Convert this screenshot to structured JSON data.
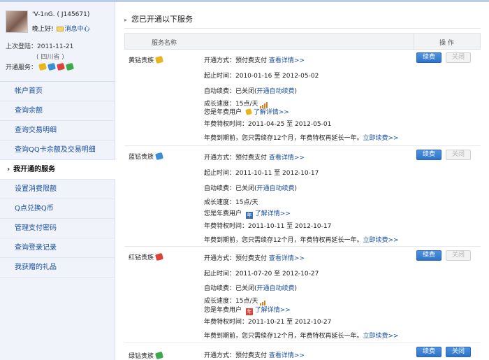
{
  "user": {
    "name": "'V-1nG. ( J145671)",
    "greeting": "晚上好!",
    "message_center": "消息中心",
    "last_login": "上次登陆：2011-11-21",
    "region": "( 四川省 )",
    "services_label": "开通服务："
  },
  "nav": [
    {
      "label": "帐户首页"
    },
    {
      "label": "查询余额"
    },
    {
      "label": "查询交易明细"
    },
    {
      "label": "查询QQ卡余额及交易明细"
    },
    {
      "label": "我开通的服务"
    },
    {
      "label": "设置消费限额"
    },
    {
      "label": "Q点兑换Q币"
    },
    {
      "label": "管理支付密码"
    },
    {
      "label": "查询登录记录"
    },
    {
      "label": "我获赠的礼品"
    }
  ],
  "main": {
    "title": "您已开通以下服务",
    "col_name": "服务名称",
    "col_op": "操  作"
  },
  "colors": {
    "yellow": "#e8b51f",
    "blue": "#3a8fd6",
    "red": "#d9453a",
    "green": "#3caa4a",
    "link": "#1a4fa3",
    "accent": "#2f73c8"
  },
  "rows": [
    {
      "name": "黄钻贵族",
      "pay_method": "开通方式：预付费支付",
      "detail_link": "查看详情>>",
      "time": "起止时间：2010-01-16 至 2012-05-02",
      "auto_renew": "自动续费：已关闭(",
      "auto_renew_link": "开通自动续费",
      "auto_renew_end": ")",
      "speed": "成长速度：15点/天",
      "year_user": "您是年费用户",
      "understand_link": "了解详情>>",
      "privilege": "年费特权时间：2011-04-25 至 2012-05-01",
      "expire": "年费到期前，您只需续存12个月，年费特权再延长一年。",
      "renew_link": "立即续费>>",
      "btn_renew": "续费",
      "btn_close": "关闭",
      "close_enabled": false
    },
    {
      "name": "蓝钻贵族",
      "pay_method": "开通方式：预付费支付",
      "detail_link": "查看详情>>",
      "time": "起止时间：2011-10-11 至 2012-10-17",
      "auto_renew": "自动续费：已关闭(",
      "auto_renew_link": "开通自动续费",
      "auto_renew_end": ")",
      "speed": "成长速度：15点/天",
      "year_user": "您是年费用户",
      "year_badge": "年",
      "understand_link": "了解详情>>",
      "privilege": "年费特权时间：2011-10-11 至 2012-10-17",
      "expire": "年费到期前，您只需续存12个月，年费特权再延长一年。",
      "renew_link": "立即续费>>",
      "btn_renew": "续费",
      "btn_close": "关闭",
      "close_enabled": false
    },
    {
      "name": "红钻贵族",
      "pay_method": "开通方式：预付费支付",
      "detail_link": "查看详情>>",
      "time": "起止时间：2011-07-20 至 2012-10-27",
      "auto_renew": "自动续费：已关闭(",
      "auto_renew_link": "开通自动续费",
      "auto_renew_end": ")",
      "speed": "成长速度：15点/天",
      "year_user": "您是年费用户",
      "year_badge": "年",
      "understand_link": "了解详情>>",
      "privilege": "年费特权时间：2011-10-21 至 2012-10-27",
      "expire": "年费到期前，您只需续存12个月，年费特权再延长一年。",
      "renew_link": "立即续费>>",
      "btn_renew": "续费",
      "btn_close": "关闭",
      "close_enabled": false
    },
    {
      "name": "绿钻贵族",
      "pay_method": "开通方式：预付费支付",
      "detail_link": "查看详情>>",
      "btn_renew": "续费",
      "btn_close": "关闭",
      "close_enabled": true
    }
  ]
}
